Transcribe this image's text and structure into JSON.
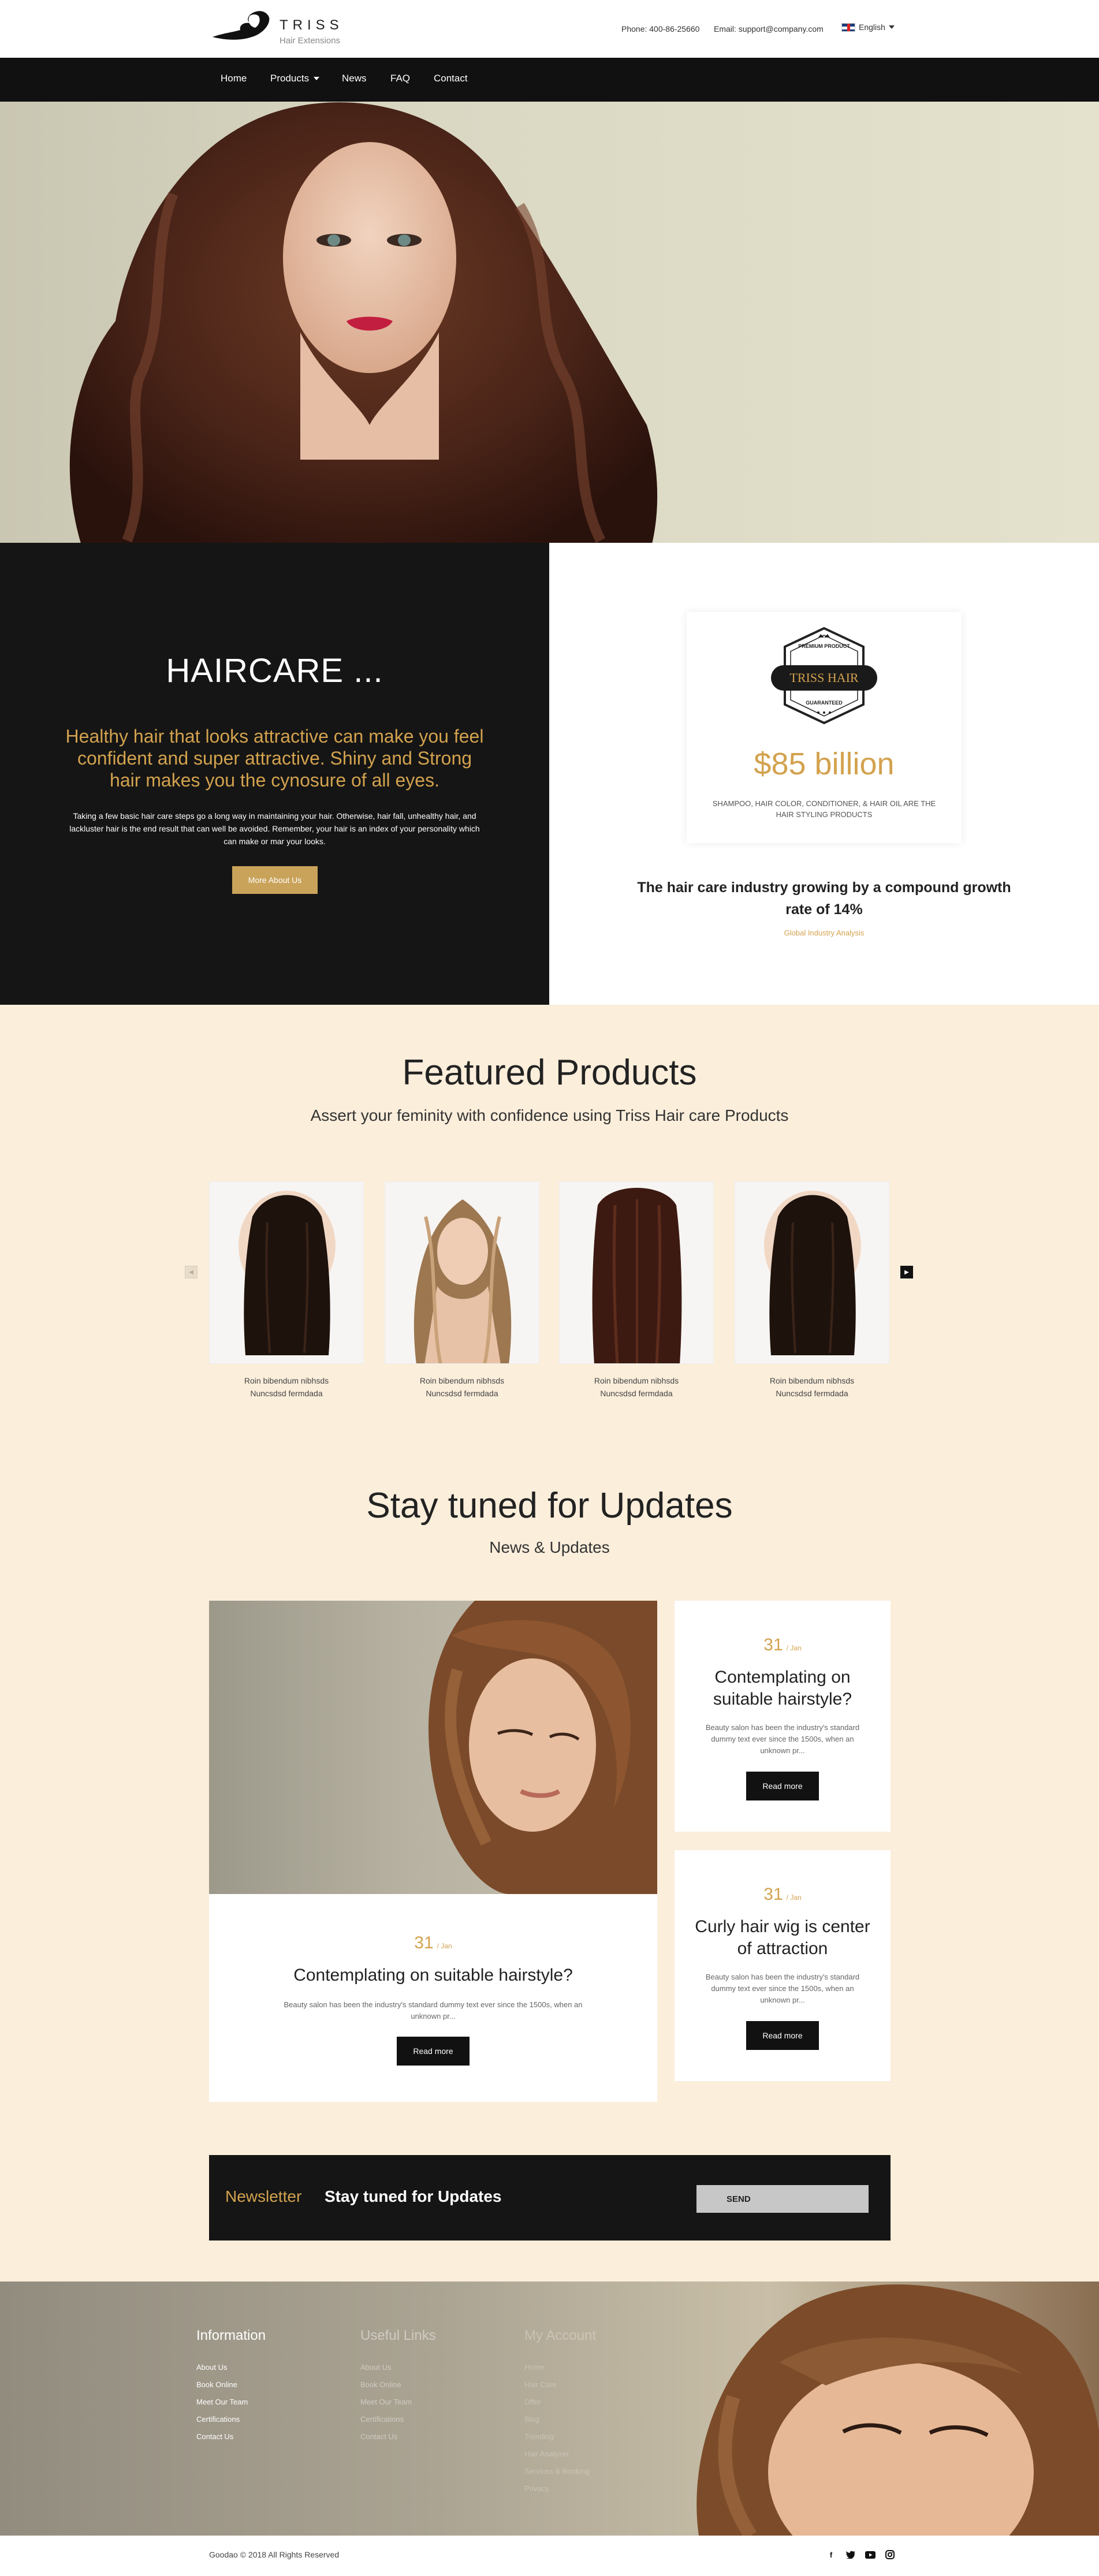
{
  "brand": {
    "name": "TRISS",
    "tagline": "Hair Extensions"
  },
  "header": {
    "phone": "Phone: 400-86-25660",
    "email": "Email: support@company.com",
    "language": "English"
  },
  "nav": {
    "items": [
      "Home",
      "Products",
      "News",
      "FAQ",
      "Contact"
    ]
  },
  "haircare": {
    "title": "HAIRCARE ...",
    "lead": "Healthy hair that looks attractive can make you feel confident and super attractive. Shiny and Strong hair makes you the cynosure of all eyes.",
    "text": "Taking a few basic hair care steps go a long way in maintaining your hair. Otherwise, hair fall, unhealthy hair, and lackluster hair is the end result that can well be avoided. Remember, your hair is an index of your personality which can make or mar your looks.",
    "button": "More About Us"
  },
  "stats": {
    "badge_top": "PREMIUM PRODUCT",
    "badge_main": "TRISS HAIR",
    "badge_bottom": "GUARANTEED",
    "value": "$85 billion",
    "description": "SHAMPOO, HAIR COLOR, CONDITIONER, & HAIR OIL ARE THE HAIR STYLING PRODUCTS",
    "headline": "The hair care industry growing by a compound growth rate of 14%",
    "link": "Global Industry Analysis"
  },
  "featured": {
    "title": "Featured Products",
    "subtitle": "Assert your feminity with confidence using Triss Hair care Products",
    "products": [
      {
        "line1": "Roin bibendum nibhsds",
        "line2": "Nuncsdsd fermdada"
      },
      {
        "line1": "Roin bibendum nibhsds",
        "line2": "Nuncsdsd fermdada"
      },
      {
        "line1": "Roin bibendum nibhsds",
        "line2": "Nuncsdsd fermdada"
      },
      {
        "line1": "Roin bibendum nibhsds",
        "line2": "Nuncsdsd fermdada"
      }
    ]
  },
  "updates": {
    "title": "Stay tuned for Updates",
    "subtitle": "News & Updates",
    "main": {
      "day": "31",
      "month": "/ Jan",
      "title": "Contemplating on suitable hairstyle?",
      "text": "Beauty salon has been the industry's standard dummy text ever since the 1500s, when an unknown pr...",
      "button": "Read more"
    },
    "side": [
      {
        "day": "31",
        "month": "/ Jan",
        "title": "Contemplating on suitable hairstyle?",
        "text": "Beauty salon has been the industry's standard dummy text ever since the 1500s, when an unknown pr...",
        "button": "Read more"
      },
      {
        "day": "31",
        "month": "/ Jan",
        "title": "Curly hair wig is center of attraction",
        "text": "Beauty salon has been the industry's standard dummy text ever since the 1500s, when an unknown pr...",
        "button": "Read more"
      }
    ]
  },
  "newsletter": {
    "label": "Newsletter",
    "title": "Stay tuned for Updates",
    "button": "SEND"
  },
  "footer": {
    "information": {
      "title": "Information",
      "links": [
        "About Us",
        "Book Online",
        "Meet Our Team",
        "Certifications",
        "Contact Us"
      ]
    },
    "useful": {
      "title": "Useful Links",
      "links": [
        "About Us",
        "Book Online",
        "Meet Our Team",
        "Certifications",
        "Contact Us"
      ]
    },
    "account": {
      "title": "My Account",
      "links": [
        "Home",
        "Hair Care",
        "Offer",
        "Blog",
        "Trending",
        "Hair Analyzer",
        "Services & Booking",
        "Privacy"
      ]
    },
    "copyright": "Goodao © 2018 All Rights Reserved",
    "social_icons": [
      "facebook-icon",
      "twitter-icon",
      "youtube-icon",
      "instagram-icon"
    ]
  },
  "colors": {
    "accent": "#d3a24e",
    "dark": "#151515",
    "cream": "#fbeedb",
    "button_gold": "#c9a35a"
  }
}
